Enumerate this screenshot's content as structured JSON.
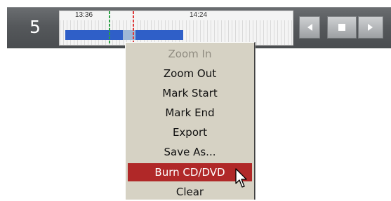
{
  "toolbar": {
    "camera_number": "5",
    "timeline": {
      "time_labels": [
        "13:36",
        "14:24"
      ]
    },
    "buttons": {
      "prev_icon": "triangle-left-icon",
      "stop_icon": "square-stop-icon",
      "next_icon": "triangle-right-icon"
    },
    "colors": {
      "recorded": "#2f5fc8",
      "selected": "#9fb8d6",
      "mark_start": "#2aa245",
      "mark_end": "#e03a3a"
    }
  },
  "context_menu": {
    "items": [
      {
        "label": "Zoom In",
        "disabled": true
      },
      {
        "label": "Zoom Out"
      },
      {
        "label": "Mark Start"
      },
      {
        "label": "Mark End"
      },
      {
        "label": "Export"
      },
      {
        "label": "Save As..."
      },
      {
        "label": "Burn CD/DVD",
        "highlighted": true
      },
      {
        "label": "Clear"
      }
    ],
    "highlight_color": "#b02828"
  }
}
